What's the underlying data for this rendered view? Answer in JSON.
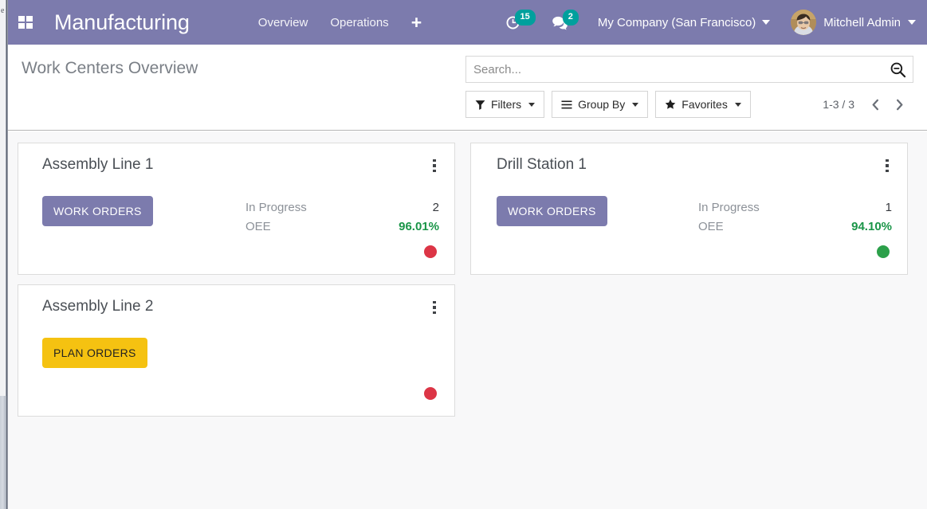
{
  "navbar": {
    "apps_icon": "apps-grid-icon",
    "brand": "Manufacturing",
    "menu": [
      {
        "label": "Overview"
      },
      {
        "label": "Operations"
      }
    ],
    "new_label": "+",
    "activities": {
      "icon": "clock-icon",
      "count": "15"
    },
    "messages": {
      "icon": "chat-icon",
      "count": "2"
    },
    "company": "My Company (San Francisco)",
    "user": "Mitchell Admin",
    "accent_color": "#7C7BAD",
    "badge_color": "#00A09D"
  },
  "control_panel": {
    "title": "Work Centers Overview",
    "search": {
      "value": "",
      "placeholder": "Search...",
      "icon": "search-icon"
    },
    "filters": [
      {
        "label": "Filters",
        "icon": "funnel-icon"
      },
      {
        "label": "Group By",
        "icon": "bars-icon"
      },
      {
        "label": "Favorites",
        "icon": "star-icon"
      }
    ],
    "pager": {
      "count": "1-3 / 3",
      "prev_icon": "chevron-left-icon",
      "next_icon": "chevron-right-icon"
    }
  },
  "board": {
    "columns": [
      {
        "cards": [
          {
            "title": "Assembly Line 1",
            "action": {
              "label": "WORK ORDERS",
              "style": "primary"
            },
            "stats": [
              {
                "label": "In Progress",
                "value": "2",
                "highlight": false
              },
              {
                "label": "OEE",
                "value": "96.01%",
                "highlight": true
              }
            ],
            "status_color": "#DC3546",
            "menu_icon": "kebab-menu-icon"
          },
          {
            "title": "Assembly Line 2",
            "action": {
              "label": "PLAN ORDERS",
              "style": "warning"
            },
            "stats": [],
            "status_color": "#DC3546",
            "menu_icon": "kebab-menu-icon"
          }
        ]
      },
      {
        "cards": [
          {
            "title": "Drill Station 1",
            "action": {
              "label": "WORK ORDERS",
              "style": "primary"
            },
            "stats": [
              {
                "label": "In Progress",
                "value": "1",
                "highlight": false
              },
              {
                "label": "OEE",
                "value": "94.10%",
                "highlight": true
              }
            ],
            "status_color": "#2CA04A",
            "menu_icon": "kebab-menu-icon"
          }
        ]
      }
    ]
  },
  "edge": {
    "ghost_letter": "e"
  }
}
